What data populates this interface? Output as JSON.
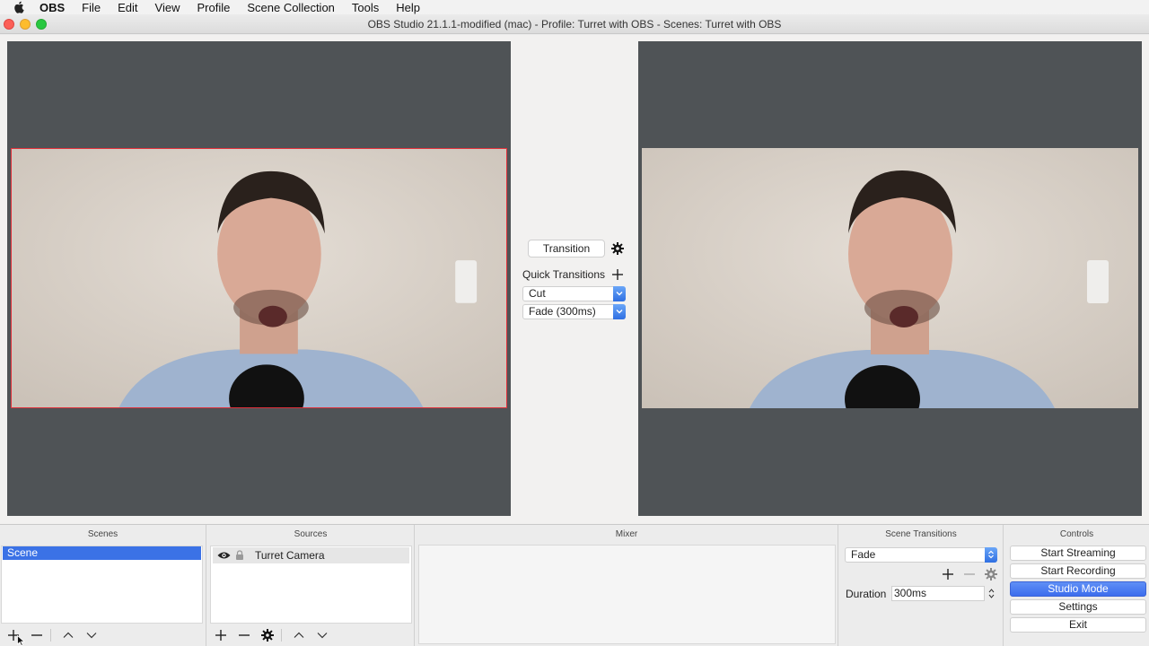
{
  "menubar": {
    "app": "OBS",
    "items": [
      "File",
      "Edit",
      "View",
      "Profile",
      "Scene Collection",
      "Tools",
      "Help"
    ]
  },
  "window": {
    "title": "OBS Studio 21.1.1-modified (mac) - Profile: Turret with OBS - Scenes: Turret with OBS"
  },
  "transition_column": {
    "transition_button": "Transition",
    "quick_transitions_label": "Quick Transitions",
    "quick_items": [
      "Cut",
      "Fade (300ms)"
    ]
  },
  "panels": {
    "scenes": {
      "header": "Scenes",
      "items": [
        "Scene"
      ]
    },
    "sources": {
      "header": "Sources",
      "items": [
        "Turret Camera"
      ]
    },
    "mixer": {
      "header": "Mixer"
    },
    "scene_transitions": {
      "header": "Scene Transitions",
      "selected": "Fade",
      "duration_label": "Duration",
      "duration_value": "300ms"
    },
    "controls": {
      "header": "Controls",
      "buttons": [
        "Start Streaming",
        "Start Recording",
        "Studio Mode",
        "Settings",
        "Exit"
      ],
      "active": "Studio Mode"
    }
  },
  "colors": {
    "selection": "#3b72e6",
    "canvas_bg": "#4f5356",
    "preview_border": "#e0303a"
  }
}
